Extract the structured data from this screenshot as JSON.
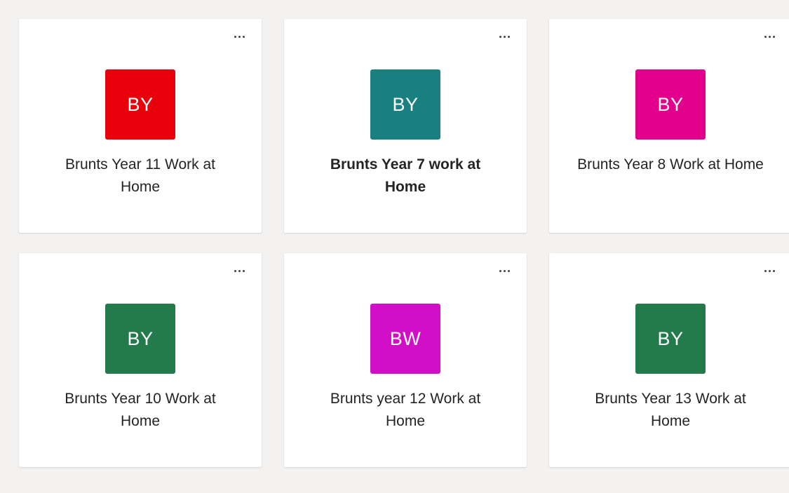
{
  "teams": [
    {
      "initials": "BY",
      "name": "Brunts Year 11 Work at Home",
      "color": "#e8000b",
      "unread": false
    },
    {
      "initials": "BY",
      "name": "Brunts Year 7 work at Home",
      "color": "#1a7f80",
      "unread": true
    },
    {
      "initials": "BY",
      "name": "Brunts Year 8 Work at Home",
      "color": "#e3008c",
      "unread": false
    },
    {
      "initials": "BY",
      "name": "Brunts Year 10 Work at Home",
      "color": "#237b4b",
      "unread": false
    },
    {
      "initials": "BW",
      "name": "Brunts year 12 Work at Home",
      "color": "#d10fc6",
      "unread": false
    },
    {
      "initials": "BY",
      "name": "Brunts Year 13 Work at Home",
      "color": "#237b4b",
      "unread": false
    }
  ]
}
